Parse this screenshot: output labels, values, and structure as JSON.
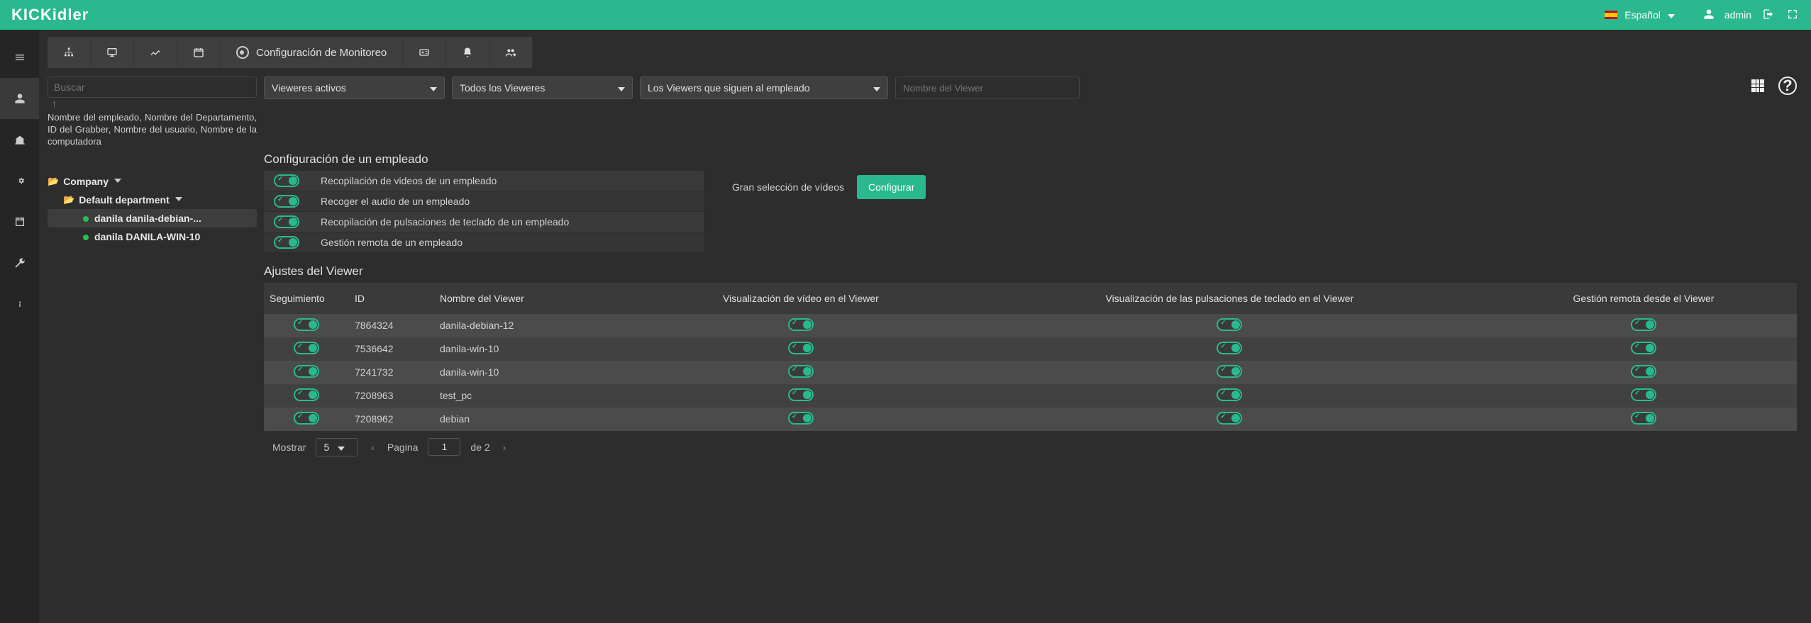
{
  "header": {
    "logo": "KICKidler",
    "language": "Español",
    "user": "admin"
  },
  "toolbar": {
    "config_label": "Configuración de Monitoreo"
  },
  "search": {
    "placeholder": "Buscar",
    "hint": "Nombre del empleado, Nombre del Departamento, ID del Grabber, Nombre del usuario, Nombre de la computadora"
  },
  "filters": {
    "active_viewers": "Vieweres activos",
    "all_viewers": "Todos los Vieweres",
    "following_viewers": "Los Viewers que siguen al empleado",
    "viewer_name_placeholder": "Nombre del Viewer"
  },
  "tree": {
    "company": "Company",
    "department": "Default department",
    "user1": "danila danila-debian-...",
    "user2": "danila DANILA-WIN-10"
  },
  "emp": {
    "title": "Configuración de un empleado",
    "opt_video": "Recopilación de videos de un empleado",
    "opt_audio": "Recoger el audio de un empleado",
    "opt_keys": "Recopilación de pulsaciones de teclado de un empleado",
    "opt_remote": "Gestión remota de un empleado",
    "big_video_label": "Gran selección de vídeos",
    "configure_btn": "Configurar"
  },
  "viewer": {
    "title": "Ajustes del Viewer",
    "col_follow": "Seguimiento",
    "col_id": "ID",
    "col_name": "Nombre del Viewer",
    "col_video": "Visualización de vídeo en el Viewer",
    "col_keys": "Visualización de las pulsaciones de teclado en el Viewer",
    "col_remote": "Gestión remota desde el Viewer",
    "rows": [
      {
        "id": "7864324",
        "name": "danila-debian-12"
      },
      {
        "id": "7536642",
        "name": "danila-win-10"
      },
      {
        "id": "7241732",
        "name": "danila-win-10"
      },
      {
        "id": "7208963",
        "name": "test_pc"
      },
      {
        "id": "7208962",
        "name": "debian"
      }
    ]
  },
  "pager": {
    "show": "Mostrar",
    "page_size": "5",
    "page_label": "Pagina",
    "page_current": "1",
    "page_total": "de 2"
  }
}
